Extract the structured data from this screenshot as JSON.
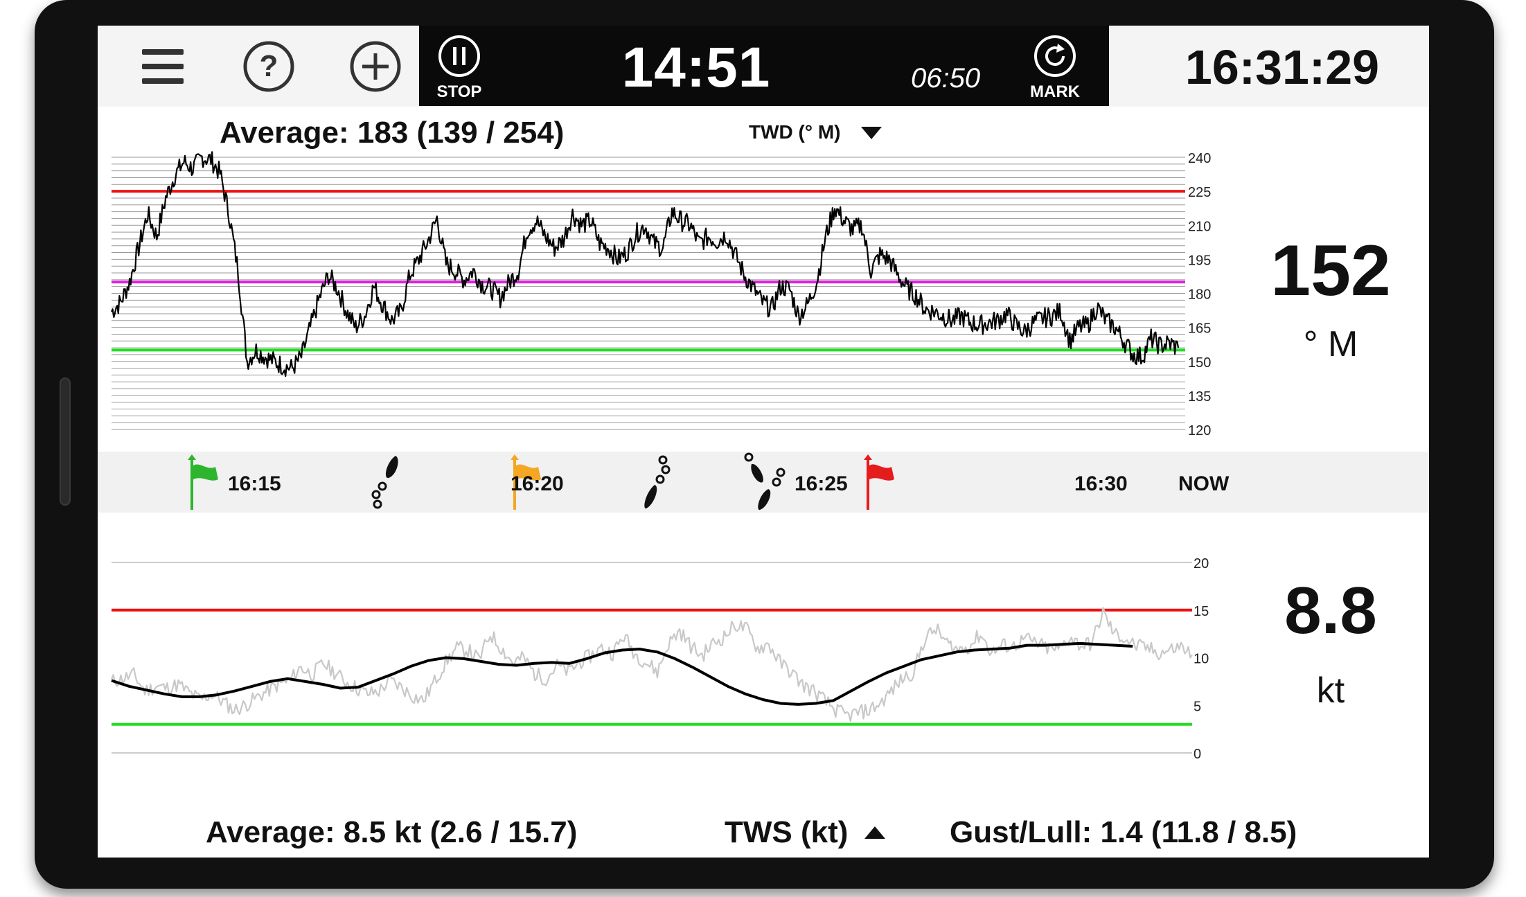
{
  "topbar": {
    "menu_icon": "hamburger-menu-icon",
    "help_icon": "help-circle-icon",
    "add_icon": "add-circle-icon",
    "stop_label": "STOP",
    "mark_label": "MARK",
    "timer_main": "14:51",
    "timer_sub": "06:50",
    "clock": "16:31:29"
  },
  "direction_panel": {
    "average_text": "Average: 183 (139 / 254)",
    "selector_label": "TWD (° M)",
    "current_value": "152",
    "unit": "° M"
  },
  "timeline": {
    "labels": [
      "16:15",
      "16:20",
      "16:25",
      "16:30",
      "NOW"
    ],
    "markers": [
      "green-flag-icon",
      "footprints-icon",
      "orange-flag-icon",
      "footprints-icon",
      "footprints-icon",
      "red-flag-icon"
    ]
  },
  "speed_panel": {
    "average_text": "Average: 8.5 kt (2.6 / 15.7)",
    "selector_label": "TWS (kt)",
    "gust_text": "Gust/Lull: 1.4 (11.8 / 8.5)",
    "current_value": "8.8",
    "unit": "kt"
  },
  "colors": {
    "max_line": "#ee1111",
    "min_line": "#22dd22",
    "avg_line": "#dd22dd",
    "green_flag": "#2db52d",
    "orange_flag": "#f5a623",
    "red_flag": "#e51c1c",
    "raw_speed": "#c8c8c8",
    "trace": "#000000"
  },
  "chart_data": [
    {
      "type": "line",
      "title": "",
      "ylim": [
        120,
        240
      ],
      "yticks": [
        120,
        135,
        150,
        165,
        180,
        195,
        210,
        225,
        240
      ],
      "grid": true,
      "reference_lines": {
        "max": 225,
        "average": 185,
        "min": 155
      },
      "series": [
        {
          "values": [
            172,
            176,
            185,
            200,
            215,
            205,
            222,
            232,
            238,
            235,
            240,
            239,
            233,
            215,
            190,
            150,
            155,
            152,
            150,
            148,
            147,
            152,
            165,
            178,
            188,
            182,
            172,
            165,
            170,
            183,
            175,
            168,
            172,
            188,
            195,
            203,
            213,
            193,
            190,
            186,
            190,
            184,
            182,
            178,
            185,
            190,
            208,
            212,
            205,
            200,
            204,
            215,
            210,
            212,
            202,
            200,
            195,
            198,
            206,
            210,
            202,
            200,
            216,
            212,
            210,
            202,
            205,
            203,
            206,
            197,
            188,
            182,
            176,
            173,
            183,
            182,
            170,
            175,
            185,
            205,
            218,
            212,
            208,
            210,
            190,
            197,
            195,
            188,
            182,
            179,
            173,
            172,
            170,
            168,
            170,
            167,
            166,
            167,
            168,
            171,
            166,
            163,
            167,
            169,
            170,
            172,
            159,
            165,
            166,
            174,
            168,
            165,
            159,
            153,
            152,
            160,
            157,
            158,
            156
          ]
        }
      ]
    },
    {
      "type": "line",
      "title": "",
      "ylim": [
        0,
        20
      ],
      "yticks": [
        0,
        5,
        10,
        15,
        20
      ],
      "grid": false,
      "reference_lines": {
        "max": 15,
        "min": 3
      },
      "series": [
        {
          "values": [
            7.5,
            7.8,
            8.2,
            6.5,
            7.0,
            6.8,
            7.2,
            6.3,
            5.6,
            6.2,
            5.4,
            4.5,
            5.0,
            5.8,
            6.5,
            7.2,
            7.6,
            9.0,
            8.2,
            9.4,
            8.5,
            7.5,
            6.8,
            6.2,
            6.5,
            7.6,
            6.9,
            6.0,
            5.5,
            7.5,
            9.5,
            11.0,
            10.8,
            9.8,
            12.5,
            11.0,
            9.5,
            10.0,
            8.3,
            7.8,
            9.2,
            8.5,
            9.5,
            10.2,
            11.0,
            10.5,
            12.3,
            10.4,
            9.5,
            8.5,
            11.5,
            12.8,
            11.2,
            10.2,
            11.5,
            12.2,
            13.5,
            13.0,
            11.0,
            11.4,
            9.5,
            8.5,
            7.2,
            6.5,
            5.5,
            4.5,
            3.9,
            4.2,
            4.5,
            5.2,
            6.5,
            7.8,
            8.5,
            12.0,
            13.0,
            11.5,
            10.8,
            11.2,
            12.5,
            10.5,
            11.3,
            11.2,
            12.0,
            11.5,
            11.0,
            10.8,
            12.2,
            11.3,
            11.5,
            14.8,
            12.5,
            12.0,
            11.2,
            11.0,
            10.5,
            10.8,
            11.2,
            10.3
          ]
        },
        {
          "values": [
            7.6,
            7.0,
            6.6,
            6.2,
            5.9,
            5.9,
            6.1,
            6.5,
            7.0,
            7.5,
            7.8,
            7.5,
            7.2,
            6.8,
            6.9,
            7.6,
            8.3,
            9.1,
            9.7,
            10.0,
            9.9,
            9.6,
            9.3,
            9.2,
            9.4,
            9.5,
            9.4,
            9.9,
            10.5,
            10.8,
            10.9,
            10.6,
            9.9,
            9.0,
            8.0,
            7.0,
            6.2,
            5.6,
            5.2,
            5.1,
            5.2,
            5.5,
            6.5,
            7.5,
            8.4,
            9.1,
            9.8,
            10.2,
            10.6,
            10.8,
            10.9,
            11.0,
            11.3,
            11.3,
            11.4,
            11.5,
            11.4,
            11.3,
            11.2
          ]
        }
      ]
    }
  ]
}
